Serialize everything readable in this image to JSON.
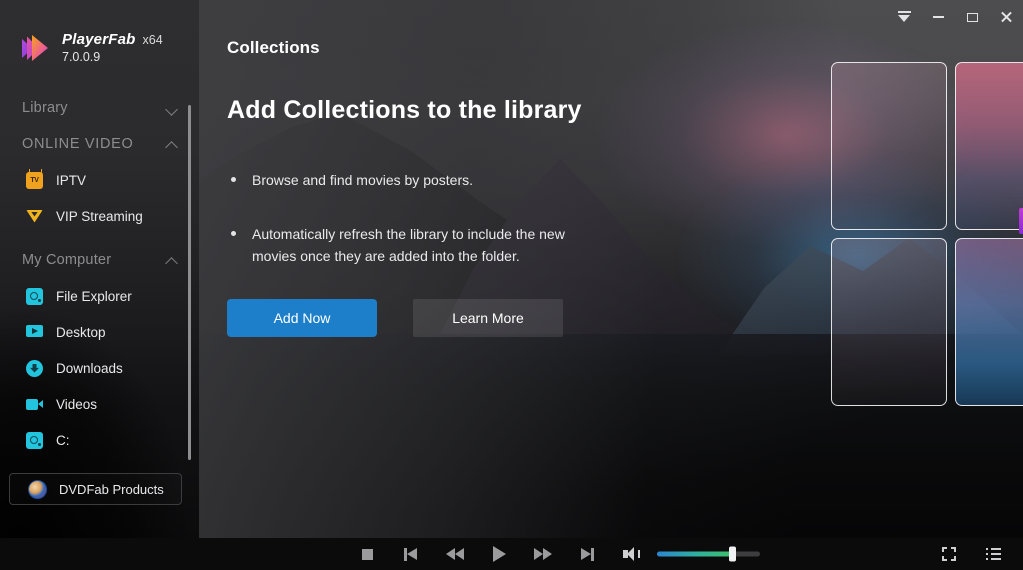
{
  "window": {
    "controls": [
      {
        "name": "tray-icon",
        "label": "Minimize to tray"
      },
      {
        "name": "minimize-icon",
        "label": "Minimize"
      },
      {
        "name": "maximize-icon",
        "label": "Maximize"
      },
      {
        "name": "close-icon",
        "label": "Close"
      }
    ]
  },
  "brand": {
    "name": "PlayerFab",
    "arch": "x64",
    "version": "7.0.0.9",
    "logo_icon": "playerfab-logo-icon"
  },
  "sidebar": {
    "groups": [
      {
        "label": "Library",
        "icon": "chevron-down-icon",
        "expanded": false,
        "items": []
      },
      {
        "label": "ONLINE VIDEO",
        "icon": "chevron-up-icon",
        "expanded": true,
        "items": [
          {
            "label": "IPTV",
            "icon": "tv-icon"
          },
          {
            "label": "VIP Streaming",
            "icon": "crown-icon"
          }
        ]
      },
      {
        "label": "My Computer",
        "icon": "chevron-up-icon",
        "expanded": true,
        "items": [
          {
            "label": "File Explorer",
            "icon": "folder-icon"
          },
          {
            "label": "Desktop",
            "icon": "desktop-icon"
          },
          {
            "label": "Downloads",
            "icon": "download-icon"
          },
          {
            "label": "Videos",
            "icon": "video-camera-icon"
          },
          {
            "label": "C:",
            "icon": "drive-icon"
          }
        ]
      }
    ],
    "promo": {
      "label": "DVDFab Products",
      "icon": "dvdfab-logo-icon"
    }
  },
  "main": {
    "page_title": "Collections",
    "hero_title": "Add Collections to the library",
    "bullets": [
      "Browse and find movies by posters.",
      "Automatically refresh the library to include the new movies once they are added into the folder."
    ],
    "primary_button": "Add Now",
    "secondary_button": "Learn More"
  },
  "player": {
    "stop": "Stop",
    "previous": "Previous",
    "rewind": "Rewind",
    "play": "Play",
    "fast_forward": "Fast Forward",
    "next": "Next",
    "volume": "Volume",
    "volume_percent": 70,
    "fullscreen": "Fullscreen",
    "playlist": "Playlist"
  },
  "colors": {
    "accent_blue": "#1d7fc9",
    "sidebar_bg": "#2b2b2d",
    "icon_cyan": "#23c4dd",
    "icon_orange": "#f0a11e",
    "edge_accent": "#c23ad6"
  }
}
